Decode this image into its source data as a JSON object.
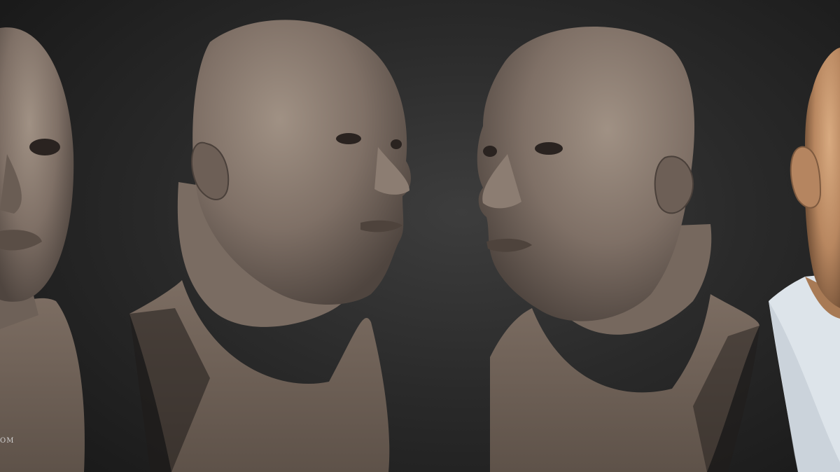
{
  "scene": {
    "background_color": "#2e2e2e",
    "clay_color": "#8a7b70",
    "skin_color": "#c4956e",
    "shirt_color": "#dde4ea",
    "watermark_text": "OM"
  }
}
